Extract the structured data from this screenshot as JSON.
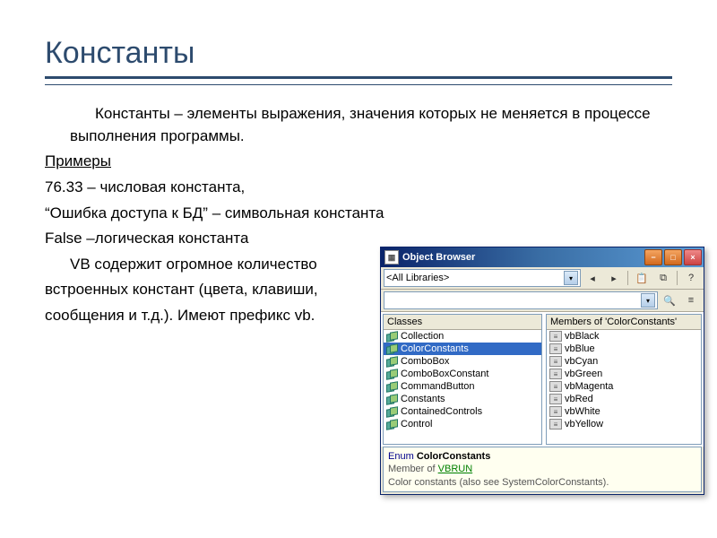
{
  "slide": {
    "title": "Константы",
    "definition": "Константы – элементы выражения, значения которых не меняется в процессе выполнения программы.",
    "examples_label": "Примеры",
    "example_numeric": "76.33 – числовая константа,",
    "example_string": "“Ошибка доступа к БД” – символьная константа",
    "example_bool": "False –логическая константа",
    "vb_line": "VB содержит огромное количество",
    "builtin_line": "встроенных констант (цвета, клавиши,",
    "prefix_line": "сообщения и т.д.). Имеют префикс vb."
  },
  "object_browser": {
    "window_title": "Object Browser",
    "library_combo": "<All Libraries>",
    "search_value": "",
    "classes_header": "Classes",
    "members_header": "Members of 'ColorConstants'",
    "classes": [
      {
        "name": "Collection",
        "selected": false
      },
      {
        "name": "ColorConstants",
        "selected": true
      },
      {
        "name": "ComboBox",
        "selected": false
      },
      {
        "name": "ComboBoxConstant",
        "selected": false
      },
      {
        "name": "CommandButton",
        "selected": false
      },
      {
        "name": "Constants",
        "selected": false
      },
      {
        "name": "ContainedControls",
        "selected": false
      },
      {
        "name": "Control",
        "selected": false
      }
    ],
    "members": [
      "vbBlack",
      "vbBlue",
      "vbCyan",
      "vbGreen",
      "vbMagenta",
      "vbRed",
      "vbWhite",
      "vbYellow"
    ],
    "footer": {
      "keyword": "Enum",
      "name": "ColorConstants",
      "member_of_label": "Member of",
      "library": "VBRUN",
      "description": "Color constants (also see SystemColorConstants)."
    }
  }
}
